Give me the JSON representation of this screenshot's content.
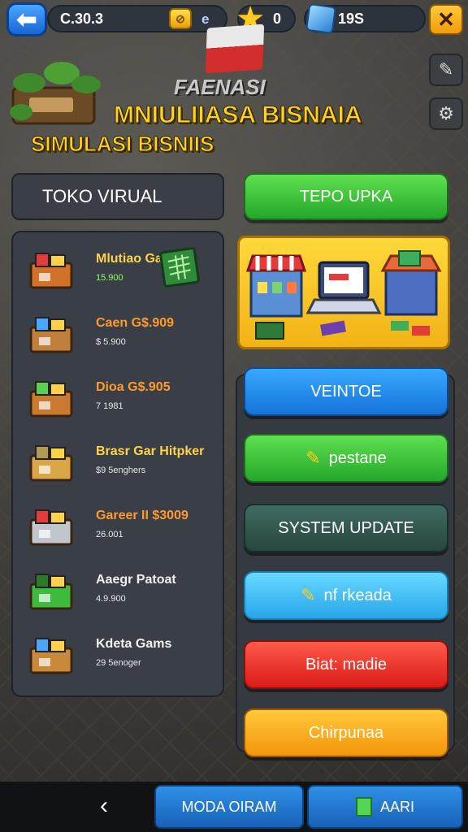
{
  "topbar": {
    "money": "C.30.3",
    "coin_text": "e",
    "coin_symbol": "⊘",
    "stars": "0",
    "gems": "19S"
  },
  "header": {
    "logo_text": "FAENASI",
    "title_line1": "MNIULIIASA BISNAIA",
    "title_line2": "SIMULASI BISNIIS"
  },
  "left_panel": {
    "tab_label": "TOKO VIRUAL",
    "items": [
      {
        "name": "Mlutiao Gat",
        "sub": "15.900",
        "name_color": "#ffd24a",
        "sub_color": "#8dff5a",
        "icon": "shop-crate-icon"
      },
      {
        "name": "Caen G$.909",
        "sub": "$ 5.900",
        "name_color": "#ff9a2a",
        "sub_color": "#e8e8e8",
        "icon": "goods-box-icon"
      },
      {
        "name": "Dioa G$.905",
        "sub": "7 1981",
        "name_color": "#ff9a2a",
        "sub_color": "#e8e8e8",
        "icon": "fruit-crate-icon"
      },
      {
        "name": "Brasr Gar Hitpker",
        "sub": "$9 5enghers",
        "name_color": "#ffd24a",
        "sub_color": "#e8e8e8",
        "icon": "cash-tray-icon"
      },
      {
        "name": "Gareer II $3009",
        "sub": "26.001",
        "name_color": "#ff9a2a",
        "sub_color": "#e8e8e8",
        "icon": "shopping-cart-icon"
      },
      {
        "name": "Aaegr Patoat",
        "sub": "4.9.900",
        "name_color": "#f0f0f0",
        "sub_color": "#e8e8e8",
        "icon": "green-box-icon"
      },
      {
        "name": "Kdeta Gams",
        "sub": "29 5enoger",
        "name_color": "#f0f0f0",
        "sub_color": "#e8e8e8",
        "icon": "gem-crate-icon"
      }
    ]
  },
  "right_panel": {
    "top_button": "TEPO UPKA",
    "buttons": [
      {
        "label": "VEINTOE",
        "style": "btn-blue",
        "icon": ""
      },
      {
        "label": "pestane",
        "style": "btn-green",
        "icon": "✎"
      },
      {
        "label": "SYSTEM UPDATE",
        "style": "btn-teal",
        "icon": ""
      },
      {
        "label": "nf rkeada",
        "style": "btn-sky",
        "icon": "✎"
      },
      {
        "label": "Biat: madie",
        "style": "btn-red",
        "icon": ""
      },
      {
        "label": "Chirpunaa",
        "style": "btn-orange",
        "icon": ""
      }
    ]
  },
  "bottom": {
    "back_symbol": "‹",
    "left_button": "MODA OIRAM",
    "right_button": "AARI"
  }
}
